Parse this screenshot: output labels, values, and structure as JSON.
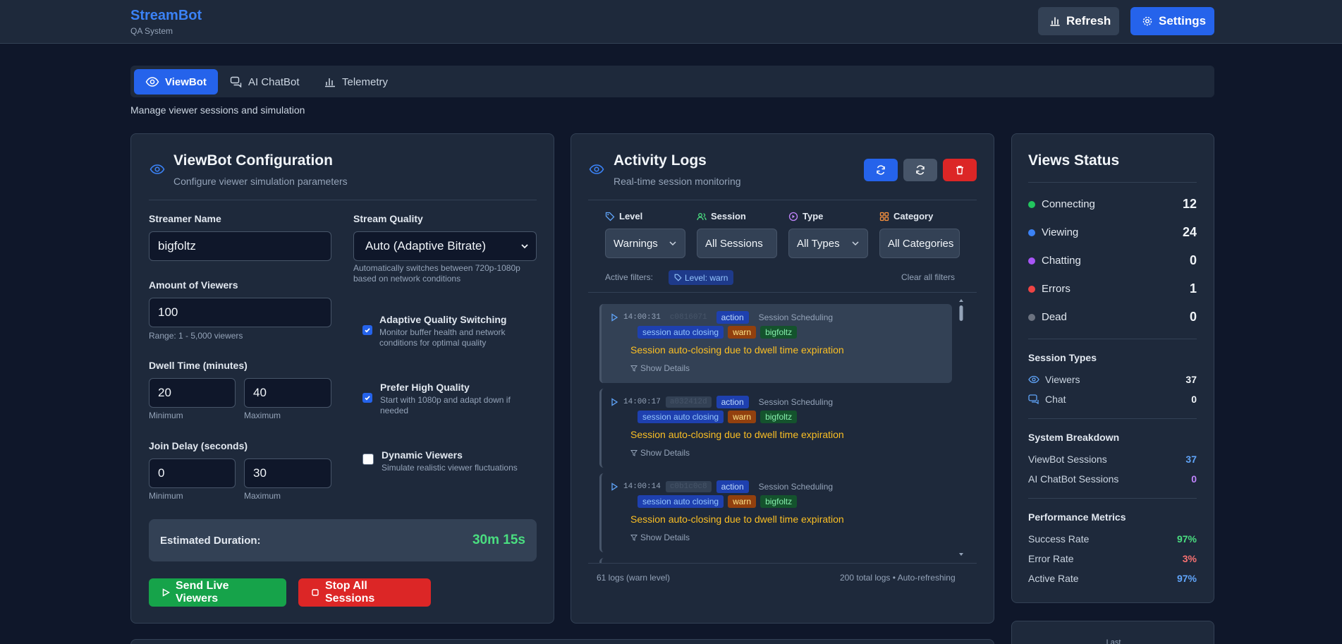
{
  "header": {
    "brand": "StreamBot",
    "brand_sub": "QA System",
    "refresh_label": "Refresh",
    "settings_label": "Settings"
  },
  "tabs": [
    {
      "label": "ViewBot",
      "icon": "eye-icon"
    },
    {
      "label": "AI ChatBot",
      "icon": "chat-icon"
    },
    {
      "label": "Telemetry",
      "icon": "bar-chart-icon"
    }
  ],
  "page_subtitle": "Manage viewer sessions and simulation",
  "config": {
    "title": "ViewBot Configuration",
    "subtitle": "Configure viewer simulation parameters",
    "streamer_name_label": "Streamer Name",
    "streamer_name_value": "bigfoltz",
    "stream_quality_label": "Stream Quality",
    "stream_quality_value": "Auto (Adaptive Bitrate)",
    "stream_quality_hint": "Automatically switches between 720p-1080p based on network conditions",
    "viewers_label": "Amount of Viewers",
    "viewers_value": "100",
    "viewers_hint": "Range: 1 - 5,000 viewers",
    "dwell_label": "Dwell Time (minutes)",
    "dwell_min": "20",
    "dwell_max": "40",
    "join_label": "Join Delay (seconds)",
    "join_min": "0",
    "join_max": "30",
    "minimum": "Minimum",
    "maximum": "Maximum",
    "adaptive_title": "Adaptive Quality Switching",
    "adaptive_desc": "Monitor buffer health and network conditions for optimal quality",
    "adaptive_checked": true,
    "prefer_title": "Prefer High Quality",
    "prefer_desc": "Start with 1080p and adapt down if needed",
    "prefer_checked": true,
    "dynamic_title": "Dynamic Viewers",
    "dynamic_desc": "Simulate realistic viewer fluctuations",
    "dynamic_checked": false,
    "estimated_label": "Estimated Duration:",
    "estimated_value": "30m 15s",
    "send_label": "Send Live Viewers",
    "stop_label": "Stop All Sessions"
  },
  "logs": {
    "title": "Activity Logs",
    "subtitle": "Real-time session monitoring",
    "filters": {
      "level_label": "Level",
      "level_value": "Warnings",
      "session_label": "Session",
      "session_value": "All Sessions",
      "type_label": "Type",
      "type_value": "All Types",
      "category_label": "Category",
      "category_value": "All Categories"
    },
    "active_filters_label": "Active filters:",
    "active_filter_chip": "Level: warn",
    "clear_filters": "Clear all filters",
    "entries": [
      {
        "time": "14:00:31",
        "session": "c0816071",
        "type": "action",
        "category": "Session Scheduling",
        "tags": [
          "session auto closing",
          "warn",
          "bigfoltz"
        ],
        "message": "Session auto-closing due to dwell time expiration",
        "details": "Show Details"
      },
      {
        "time": "14:00:17",
        "session": "a032412d",
        "type": "action",
        "category": "Session Scheduling",
        "tags": [
          "session auto closing",
          "warn",
          "bigfoltz"
        ],
        "message": "Session auto-closing due to dwell time expiration",
        "details": "Show Details"
      },
      {
        "time": "14:00:14",
        "session": "c0b1c0c8",
        "type": "action",
        "category": "Session Scheduling",
        "tags": [
          "session auto closing",
          "warn",
          "bigfoltz"
        ],
        "message": "Session auto-closing due to dwell time expiration",
        "details": "Show Details"
      }
    ],
    "footer_left": "61 logs (warn level)",
    "footer_right": "200 total logs • Auto-refreshing"
  },
  "status": {
    "title": "Views Status",
    "items": [
      {
        "label": "Connecting",
        "value": "12",
        "color": "#22c55e"
      },
      {
        "label": "Viewing",
        "value": "24",
        "color": "#3b82f6"
      },
      {
        "label": "Chatting",
        "value": "0",
        "color": "#a855f7"
      },
      {
        "label": "Errors",
        "value": "1",
        "color": "#ef4444"
      },
      {
        "label": "Dead",
        "value": "0",
        "color": "#6b7280"
      }
    ],
    "session_types_title": "Session Types",
    "viewers_label": "Viewers",
    "viewers_value": "37",
    "chat_label": "Chat",
    "chat_value": "0",
    "breakdown_title": "System Breakdown",
    "viewbot_sessions_label": "ViewBot Sessions",
    "viewbot_sessions_value": "37",
    "chatbot_sessions_label": "AI ChatBot Sessions",
    "chatbot_sessions_value": "0",
    "perf_title": "Performance Metrics",
    "success_label": "Success Rate",
    "success_value": "97%",
    "error_label": "Error Rate",
    "error_value": "3%",
    "active_label": "Active Rate",
    "active_value": "97%",
    "last_label": "Last"
  }
}
